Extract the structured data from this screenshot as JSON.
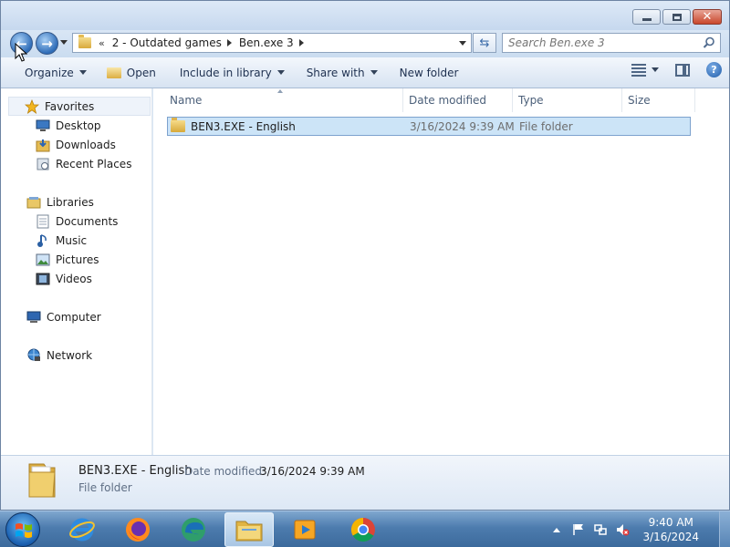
{
  "window": {
    "close_symbol": "✕"
  },
  "nav": {
    "back_symbol": "←",
    "forward_symbol": "→",
    "breadcrumb_overflow": "«",
    "breadcrumbs": [
      "2 - Outdated games",
      "Ben.exe 3"
    ],
    "refresh_symbol": "⇆"
  },
  "search": {
    "placeholder": "Search Ben.exe 3"
  },
  "toolbar": {
    "organize": "Organize",
    "open": "Open",
    "include_in_library": "Include in library",
    "share_with": "Share with",
    "new_folder": "New folder",
    "help_symbol": "?"
  },
  "navpane": {
    "favorites": "Favorites",
    "desktop": "Desktop",
    "downloads": "Downloads",
    "recent_places": "Recent Places",
    "libraries": "Libraries",
    "documents": "Documents",
    "music": "Music",
    "pictures": "Pictures",
    "videos": "Videos",
    "computer": "Computer",
    "network": "Network"
  },
  "columns": {
    "name": "Name",
    "date_modified": "Date modified",
    "type": "Type",
    "size": "Size"
  },
  "files": [
    {
      "name": "BEN3.EXE - English",
      "date_modified": "3/16/2024 9:39 AM",
      "type": "File folder",
      "size": ""
    }
  ],
  "details": {
    "name": "BEN3.EXE - English",
    "date_modified_label": "Date modified:",
    "date_modified_value": "3/16/2024 9:39 AM",
    "type": "File folder"
  },
  "taskbar": {
    "apps": [
      "internet-explorer",
      "firefox",
      "edge",
      "file-explorer",
      "media-player",
      "chrome"
    ],
    "active_app": "file-explorer",
    "clock_time": "9:40 AM",
    "clock_date": "3/16/2024"
  },
  "colors": {
    "selection": "#cce4f7",
    "selection_border": "#7da2ce",
    "taskbar": "#4d7cae",
    "close_button": "#c9462b"
  }
}
